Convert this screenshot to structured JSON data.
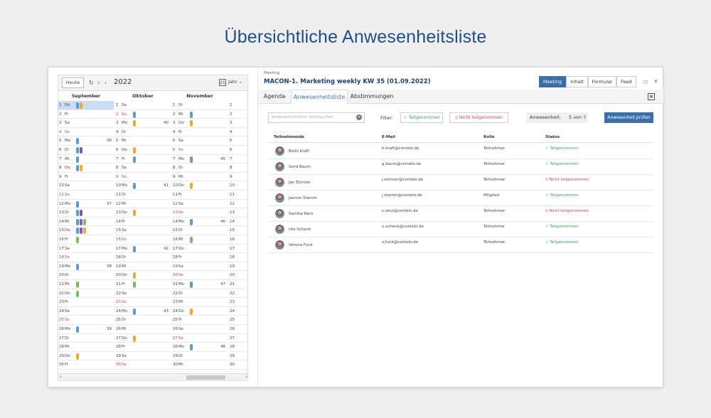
{
  "headline": "Übersichtliche Anwesenheitsliste",
  "calendar": {
    "today_label": "Heute",
    "refresh_icon": "refresh-icon",
    "year": "2022",
    "view_label": "Jahr",
    "calendar_icon_text": "21",
    "months": [
      {
        "name": "September",
        "days": [
          [
            "1",
            "Do",
            ""
          ],
          [
            "2",
            "Fr",
            ""
          ],
          [
            "3",
            "Sa",
            ""
          ],
          [
            "4",
            "So",
            ""
          ],
          [
            "5",
            "Mo",
            "36"
          ],
          [
            "6",
            "Di",
            ""
          ],
          [
            "7",
            "Mi",
            ""
          ],
          [
            "8",
            "Do",
            ""
          ],
          [
            "9",
            "Fr",
            ""
          ],
          [
            "10",
            "Sa",
            ""
          ],
          [
            "11",
            "So",
            ""
          ],
          [
            "12",
            "Mo",
            "37"
          ],
          [
            "13",
            "Di",
            ""
          ],
          [
            "14",
            "Mi",
            ""
          ],
          [
            "15",
            "Do",
            ""
          ],
          [
            "16",
            "Fr",
            ""
          ],
          [
            "17",
            "Sa",
            ""
          ],
          [
            "18",
            "So",
            ""
          ],
          [
            "19",
            "Mo",
            "38"
          ],
          [
            "20",
            "Di",
            ""
          ],
          [
            "21",
            "Mi",
            ""
          ],
          [
            "22",
            "Do",
            ""
          ],
          [
            "23",
            "Fr",
            ""
          ],
          [
            "24",
            "Sa",
            ""
          ],
          [
            "25",
            "So",
            ""
          ],
          [
            "26",
            "Mo",
            "39"
          ],
          [
            "27",
            "Di",
            ""
          ],
          [
            "28",
            "Mi",
            ""
          ],
          [
            "29",
            "Do",
            ""
          ],
          [
            "30",
            "Fr",
            ""
          ]
        ]
      },
      {
        "name": "Oktober",
        "days": [
          [
            "1",
            "Sa",
            ""
          ],
          [
            "2",
            "So",
            ""
          ],
          [
            "3",
            "Mo",
            "40"
          ],
          [
            "4",
            "Di",
            ""
          ],
          [
            "5",
            "Mi",
            ""
          ],
          [
            "6",
            "Do",
            ""
          ],
          [
            "7",
            "Fr",
            ""
          ],
          [
            "8",
            "Sa",
            ""
          ],
          [
            "9",
            "So",
            ""
          ],
          [
            "10",
            "Mo",
            "41"
          ],
          [
            "11",
            "Di",
            ""
          ],
          [
            "12",
            "Mi",
            ""
          ],
          [
            "13",
            "Do",
            ""
          ],
          [
            "14",
            "Fr",
            ""
          ],
          [
            "15",
            "Sa",
            ""
          ],
          [
            "16",
            "So",
            ""
          ],
          [
            "17",
            "Mo",
            "42"
          ],
          [
            "18",
            "Di",
            ""
          ],
          [
            "19",
            "Mi",
            ""
          ],
          [
            "20",
            "Do",
            ""
          ],
          [
            "21",
            "Fr",
            ""
          ],
          [
            "22",
            "Sa",
            ""
          ],
          [
            "23",
            "So",
            ""
          ],
          [
            "24",
            "Mo",
            "43"
          ],
          [
            "25",
            "Di",
            ""
          ],
          [
            "26",
            "Mi",
            ""
          ],
          [
            "27",
            "Do",
            ""
          ],
          [
            "28",
            "Fr",
            ""
          ],
          [
            "29",
            "Sa",
            ""
          ],
          [
            "30",
            "So",
            ""
          ]
        ]
      },
      {
        "name": "November",
        "days": [
          [
            "1",
            "Di",
            ""
          ],
          [
            "2",
            "Mi",
            ""
          ],
          [
            "3",
            "Do",
            ""
          ],
          [
            "4",
            "Fr",
            ""
          ],
          [
            "5",
            "Sa",
            ""
          ],
          [
            "6",
            "So",
            ""
          ],
          [
            "7",
            "Mo",
            "45"
          ],
          [
            "8",
            "Di",
            ""
          ],
          [
            "9",
            "Mi",
            ""
          ],
          [
            "10",
            "Do",
            ""
          ],
          [
            "11",
            "Fr",
            ""
          ],
          [
            "12",
            "Sa",
            ""
          ],
          [
            "13",
            "So",
            ""
          ],
          [
            "14",
            "Mo",
            "46"
          ],
          [
            "15",
            "Di",
            ""
          ],
          [
            "16",
            "Mi",
            ""
          ],
          [
            "17",
            "Do",
            ""
          ],
          [
            "18",
            "Fr",
            ""
          ],
          [
            "19",
            "Sa",
            ""
          ],
          [
            "20",
            "So",
            ""
          ],
          [
            "21",
            "Mo",
            "47"
          ],
          [
            "22",
            "Di",
            ""
          ],
          [
            "23",
            "Mi",
            ""
          ],
          [
            "24",
            "Do",
            ""
          ],
          [
            "25",
            "Fr",
            ""
          ],
          [
            "26",
            "Sa",
            ""
          ],
          [
            "27",
            "So",
            ""
          ],
          [
            "28",
            "Mo",
            "48"
          ],
          [
            "29",
            "Di",
            ""
          ],
          [
            "30",
            "Mi",
            ""
          ]
        ]
      },
      {
        "name": "",
        "days": [
          [
            "1",
            "",
            ""
          ],
          [
            "2",
            "",
            ""
          ],
          [
            "3",
            "",
            ""
          ],
          [
            "4",
            "",
            ""
          ],
          [
            "5",
            "",
            ""
          ],
          [
            "6",
            "",
            ""
          ],
          [
            "7",
            "",
            ""
          ],
          [
            "8",
            "",
            ""
          ],
          [
            "9",
            "",
            ""
          ],
          [
            "10",
            "",
            ""
          ],
          [
            "11",
            "",
            ""
          ],
          [
            "12",
            "",
            ""
          ],
          [
            "13",
            "",
            ""
          ],
          [
            "14",
            "",
            ""
          ],
          [
            "15",
            "",
            ""
          ],
          [
            "16",
            "",
            ""
          ],
          [
            "17",
            "",
            ""
          ],
          [
            "18",
            "",
            ""
          ],
          [
            "19",
            "",
            ""
          ],
          [
            "20",
            "",
            ""
          ],
          [
            "21",
            "",
            ""
          ],
          [
            "22",
            "",
            ""
          ],
          [
            "23",
            "",
            ""
          ],
          [
            "24",
            "",
            ""
          ],
          [
            "25",
            "",
            ""
          ],
          [
            "26",
            "",
            ""
          ],
          [
            "27",
            "",
            ""
          ],
          [
            "28",
            "",
            ""
          ],
          [
            "29",
            "",
            ""
          ],
          [
            "30",
            "",
            ""
          ]
        ]
      }
    ],
    "event_colors": {
      "blue": "#5b9bd5",
      "orange": "#f0a830",
      "purple": "#7b5bb5",
      "green": "#7cc060"
    }
  },
  "meeting": {
    "label": "Meeting",
    "title": "MACON-1. Marketing weekly KW 35 (01.09.2022)",
    "views": [
      "Meeting",
      "Inhalt",
      "Formular",
      "Feed"
    ],
    "tabs": [
      "Agenda",
      "Anwesenheitsliste",
      "Abstimmungen"
    ],
    "search_placeholder": "Anwesenheitsliste durchsuchen",
    "filter_label": "Filter:",
    "filter_ok": "✓ Teilgenommen",
    "filter_no": "⦸ Nicht teilgenommen",
    "attendance_label": "Anwesenheit:",
    "attendance_count": "5 von 7",
    "check_button": "Anwesenheit prüfen",
    "columns": [
      "Teilnehmende",
      "E-Mail",
      "Rolle",
      "Status"
    ],
    "rows": [
      {
        "name": "Bodo Kraft",
        "email": "b.kraft@contelo.de",
        "role": "Teilnehmer",
        "status": "✓ Teilgenommen",
        "ok": true
      },
      {
        "name": "Gerd Baum",
        "email": "g.baum@contelo.de",
        "role": "Teilnehmer",
        "status": "✓ Teilgenommen",
        "ok": true
      },
      {
        "name": "Jan Eichner",
        "email": "j.eichner@contelo.de",
        "role": "Teilnehmer",
        "status": "⦸ Nicht teilgenommen",
        "ok": false
      },
      {
        "name": "Jasmin Stamm",
        "email": "j.stamm@contelo.de",
        "role": "Mitglied",
        "status": "✓ Teilgenommen",
        "ok": true
      },
      {
        "name": "Sandra Renz",
        "email": "s.renz@contelo.de",
        "role": "Teilnehmer",
        "status": "⦸ Nicht teilgenommen",
        "ok": false
      },
      {
        "name": "Ute Schenk",
        "email": "u.schenk@contelo.de",
        "role": "Teilnehmer",
        "status": "✓ Teilgenommen",
        "ok": true
      },
      {
        "name": "Verona Funk",
        "email": "v.funk@contelo.de",
        "role": "Teilnehmer",
        "status": "✓ Teilgenommen",
        "ok": true
      }
    ]
  }
}
